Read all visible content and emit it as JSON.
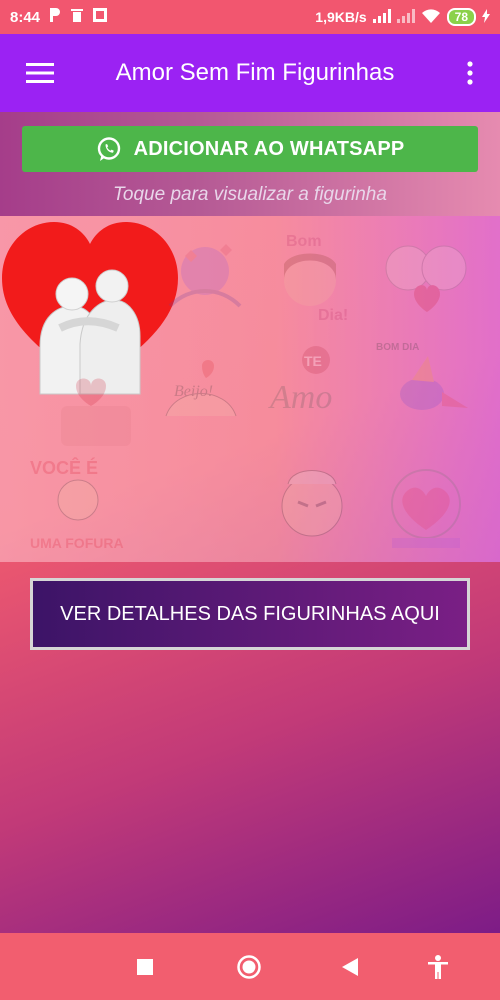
{
  "status_bar": {
    "time": "8:44",
    "net_speed": "1,9KB/s",
    "battery": "78"
  },
  "toolbar": {
    "title": "Amor Sem Fim Figurinhas"
  },
  "actions": {
    "whatsapp_label": "ADICIONAR AO WHATSAPP",
    "hint": "Toque para visualizar a figurinha",
    "details_label": "VER DETALHES DAS FIGURINHAS AQUI"
  },
  "stickers": {
    "bom_dia": "Bom",
    "dia": "Dia!",
    "beijo": "Beijo!",
    "te": "TE",
    "amo": "Amo",
    "bom_dia_small": "BOM DIA",
    "voce_e": "VOCÊ É",
    "uma_fofura": "UMA FOFURA"
  },
  "colors": {
    "accent": "#9b22f3",
    "whatsapp": "#4db64a",
    "statusbar": "#f2566f"
  }
}
